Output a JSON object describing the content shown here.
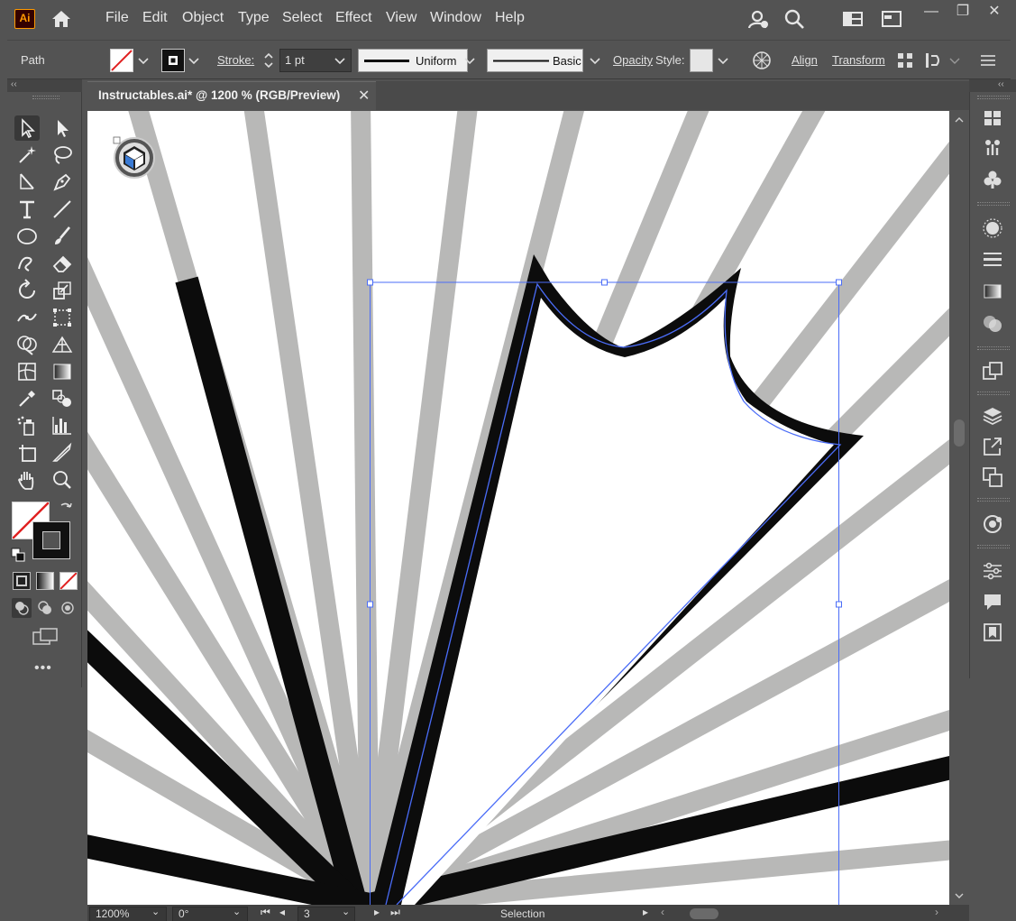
{
  "app": {
    "logo_text": "Ai"
  },
  "menu": {
    "items": [
      "File",
      "Edit",
      "Object",
      "Type",
      "Select",
      "Effect",
      "View",
      "Window",
      "Help"
    ]
  },
  "window_controls": {
    "minimize": "—",
    "restore": "❐",
    "close": "✕"
  },
  "control_bar": {
    "selection_type": "Path",
    "stroke_label": "Stroke:",
    "stroke_weight": "1 pt",
    "profile_label": "Uniform",
    "brush_label": "Basic",
    "opacity_label": "Opacity",
    "style_label": "Style:",
    "align_label": "Align",
    "transform_label": "Transform"
  },
  "document_tab": {
    "title": "Instructables.ai* @ 1200 % (RGB/Preview)",
    "close": "✕"
  },
  "status_bar": {
    "zoom": "1200%",
    "rotation": "0°",
    "artboard": "3",
    "tool_name": "Selection"
  },
  "colors": {
    "ui_bg": "#535353",
    "ray_gray": "#b8b8b7",
    "ray_black": "#0c0c0c",
    "selection_blue": "#4a6cf7",
    "fill_none_red": "#e02020"
  }
}
